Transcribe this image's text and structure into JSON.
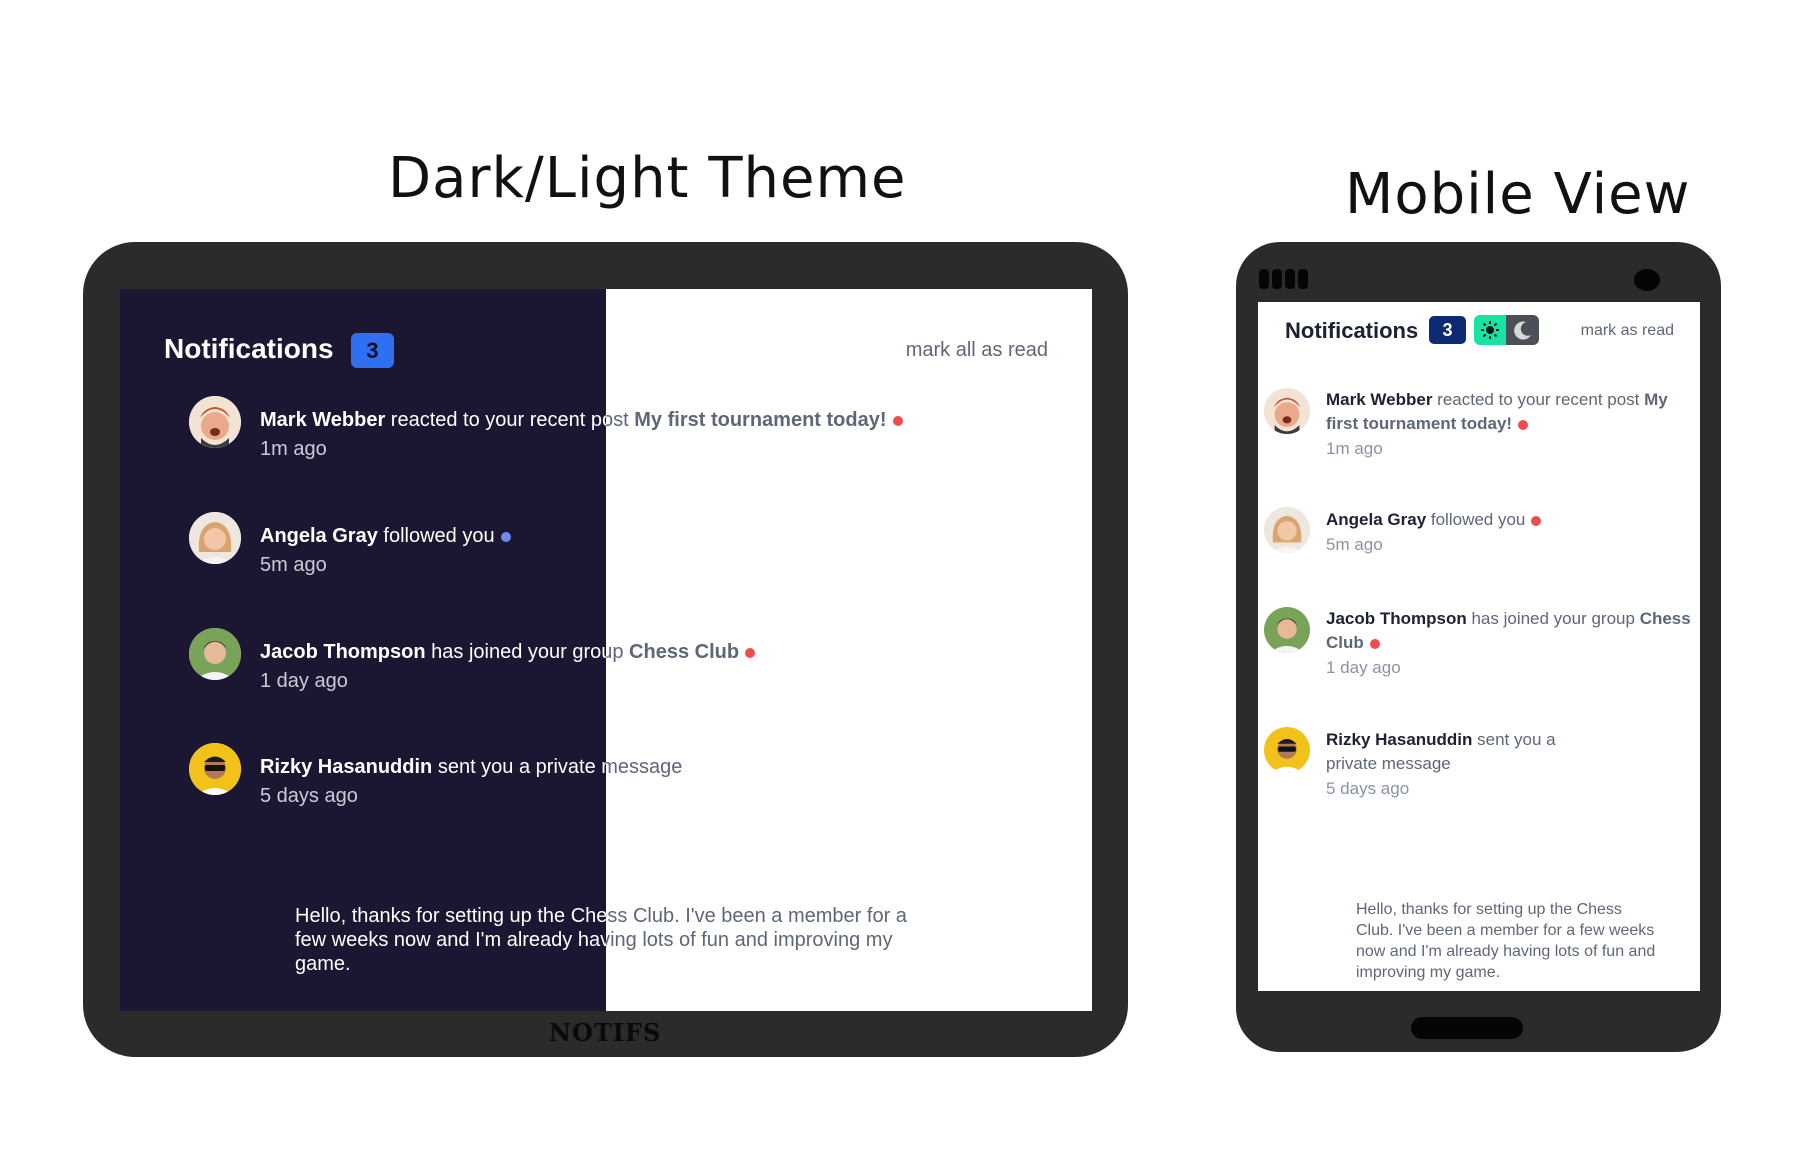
{
  "headings": {
    "left": "Dark/Light Theme",
    "right": "Mobile View"
  },
  "tablet": {
    "title": "Notifications",
    "badge": "3",
    "mark_all": "mark all as read",
    "brand": "NOTIFS",
    "notifications": [
      {
        "name": "Mark Webber",
        "action": " reacted to your recent post ",
        "target": "My first tournament today!",
        "time": "1m ago",
        "unread": true
      },
      {
        "name": "Angela Gray",
        "action": " followed you",
        "target": "",
        "time": "5m ago",
        "unread": true
      },
      {
        "name": "Jacob Thompson",
        "action": " has joined your group ",
        "target": "Chess Club",
        "time": "1 day ago",
        "unread": true
      },
      {
        "name": "Rizky Hasanuddin",
        "action": " sent you a private message",
        "target": "",
        "time": "5 days ago",
        "unread": false
      }
    ],
    "message": "Hello, thanks for setting up the Chess Club. I've been a member for a few weeks now and I'm already having lots of fun and improving my game."
  },
  "phone": {
    "title": "Notifications",
    "badge": "3",
    "mark_all": "mark as read",
    "notifications": [
      {
        "name": "Mark Webber",
        "action": " reacted to your recent post ",
        "target": "My first tournament today!",
        "time": "1m ago"
      },
      {
        "name": "Angela Gray",
        "action": " followed you",
        "target": "",
        "time": "5m ago"
      },
      {
        "name": "Jacob Thompson",
        "action": " has joined your group ",
        "target": "Chess Club",
        "time": "1 day ago"
      },
      {
        "name": "Rizky Hasanuddin",
        "action": " sent you a private message",
        "target": "",
        "time": "5 days ago"
      }
    ],
    "message": "Hello, thanks for setting up the Chess Club. I've been a member for a few weeks now and I'm already having lots of fun and improving my game."
  },
  "colors": {
    "dark_bg": "#1b1733",
    "badge_blue": "#2f6ff1",
    "badge_navy": "#0d2a72",
    "unread_dot": "#ee4d4d",
    "toggle_sun": "#18e2a4"
  }
}
